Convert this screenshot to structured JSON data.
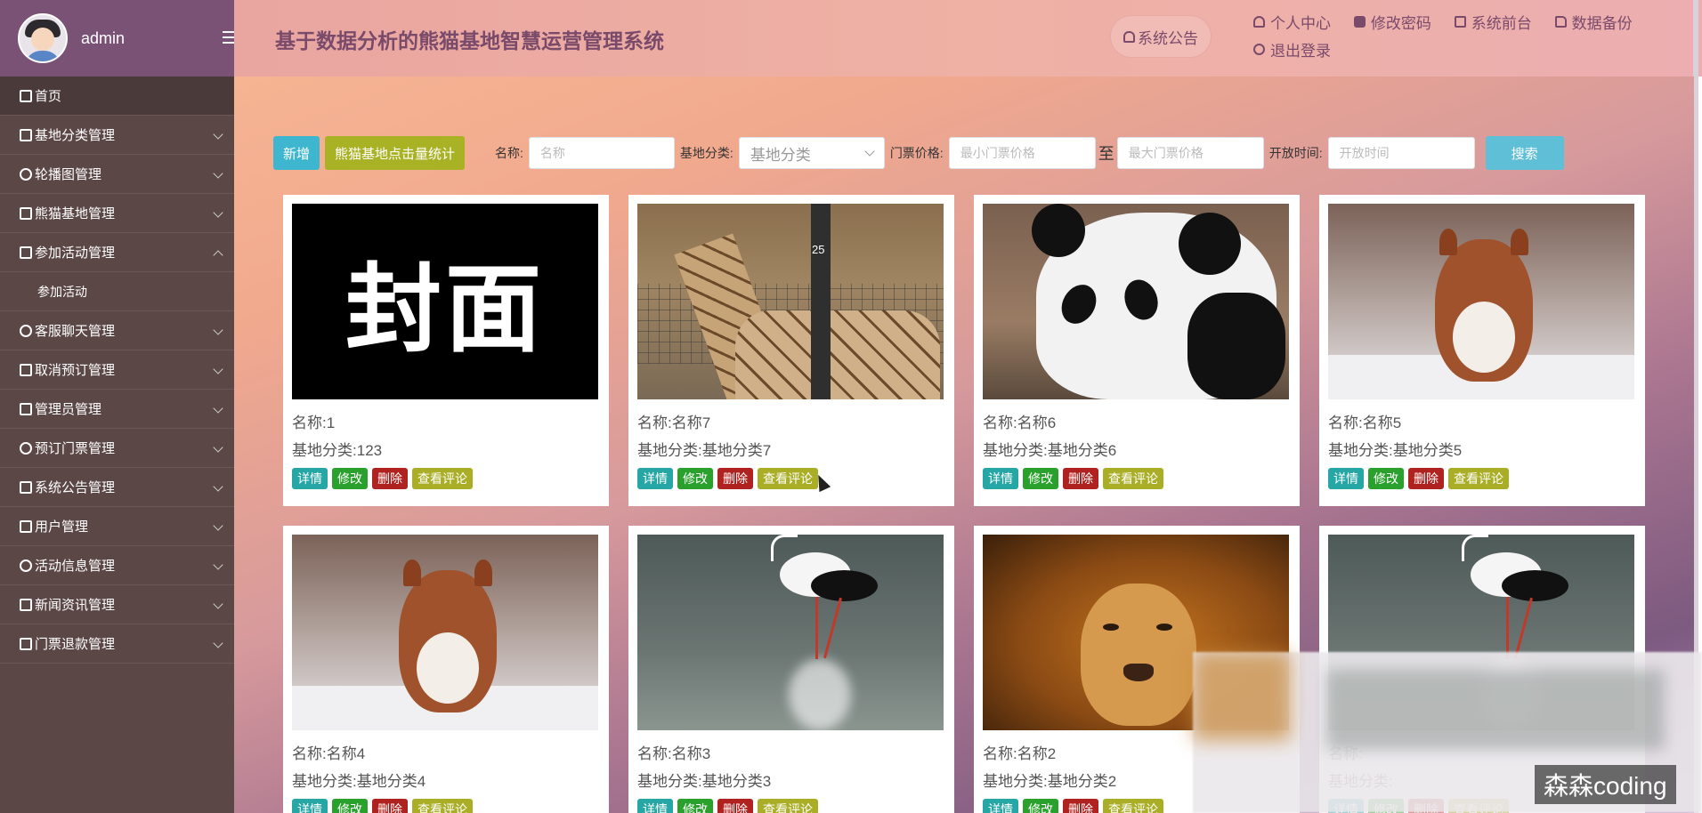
{
  "sidebar": {
    "user": "admin",
    "home": "首页",
    "menus": [
      {
        "label": "基地分类管理",
        "open": false
      },
      {
        "label": "轮播图管理",
        "open": false
      },
      {
        "label": "熊猫基地管理",
        "open": false
      },
      {
        "label": "参加活动管理",
        "open": true,
        "sub": [
          "参加活动"
        ]
      },
      {
        "label": "客服聊天管理",
        "open": false
      },
      {
        "label": "取消预订管理",
        "open": false
      },
      {
        "label": "管理员管理",
        "open": false
      },
      {
        "label": "预订门票管理",
        "open": false
      },
      {
        "label": "系统公告管理",
        "open": false
      },
      {
        "label": "用户管理",
        "open": false
      },
      {
        "label": "活动信息管理",
        "open": false
      },
      {
        "label": "新闻资讯管理",
        "open": false
      },
      {
        "label": "门票退款管理",
        "open": false
      }
    ]
  },
  "header": {
    "title": "基于数据分析的熊猫基地智慧运营管理系统",
    "notice": "系统公告",
    "links": [
      "个人中心",
      "修改密码",
      "系统前台",
      "数据备份",
      "退出登录"
    ]
  },
  "toolbar": {
    "add": "新增",
    "stat": "熊猫基地点击量统计",
    "name_label": "名称:",
    "name_placeholder": "名称",
    "category_label": "基地分类:",
    "category_placeholder": "基地分类",
    "price_label": "门票价格:",
    "price_min_placeholder": "最小门票价格",
    "price_sep": "至",
    "price_max_placeholder": "最大门票价格",
    "time_label": "开放时间:",
    "time_placeholder": "开放时间",
    "search": "搜索"
  },
  "card_labels": {
    "name_prefix": "名称:",
    "category_prefix": "基地分类:",
    "detail": "详情",
    "edit": "修改",
    "delete": "删除",
    "review": "查看评论"
  },
  "cards": [
    {
      "name": "1",
      "category": "123",
      "image": "cover",
      "cover_text": "封面"
    },
    {
      "name": "名称7",
      "category": "基地分类7",
      "image": "giraffe"
    },
    {
      "name": "名称6",
      "category": "基地分类6",
      "image": "panda"
    },
    {
      "name": "名称5",
      "category": "基地分类5",
      "image": "squirrel"
    },
    {
      "name": "名称4",
      "category": "基地分类4",
      "image": "squirrel"
    },
    {
      "name": "名称3",
      "category": "基地分类3",
      "image": "stork"
    },
    {
      "name": "名称2",
      "category": "基地分类2",
      "image": "lion"
    },
    {
      "name": "",
      "category": "",
      "image": "stork"
    }
  ],
  "watermark": "森森coding"
}
